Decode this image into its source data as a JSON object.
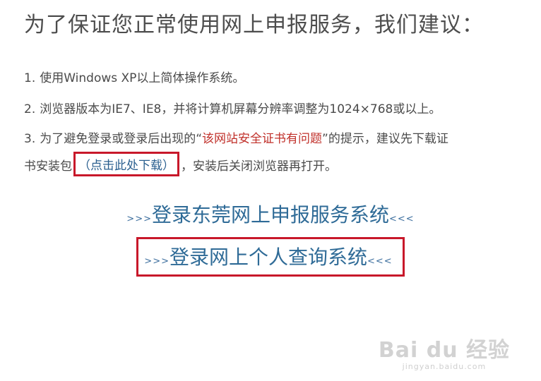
{
  "heading": "为了保证您正常使用网上申报服务，我们建议：",
  "instructions": {
    "item1": {
      "num": "1.",
      "text": "使用Windows XP以上简体操作系统。"
    },
    "item2": {
      "num": "2.",
      "text": "浏览器版本为IE7、IE8，并将计算机屏幕分辨率调整为1024×768或以上。"
    },
    "item3": {
      "num": "3.",
      "text_before": "为了避免登录或登录后出现的",
      "quote_open": "“",
      "warning": "该网站安全证书有问题",
      "quote_close": "”",
      "text_after": "的提示，建议先下载证",
      "line2_before": "书安装包",
      "download_link": "（点击此处下载）",
      "line2_after": "，安装后关闭浏览器再打开。"
    }
  },
  "links": {
    "arrow_left": ">>>",
    "arrow_right": "<<<",
    "declaration_system": "登录东莞网上申报服务系统",
    "personal_query_system": "登录网上个人查询系统"
  },
  "watermark": {
    "logo": "Bai du 经验",
    "sub": "jingyan.baidu.com"
  },
  "colors": {
    "warning_red": "#c0302a",
    "link_blue": "#2f6b97",
    "highlight_border": "#c8182a"
  }
}
